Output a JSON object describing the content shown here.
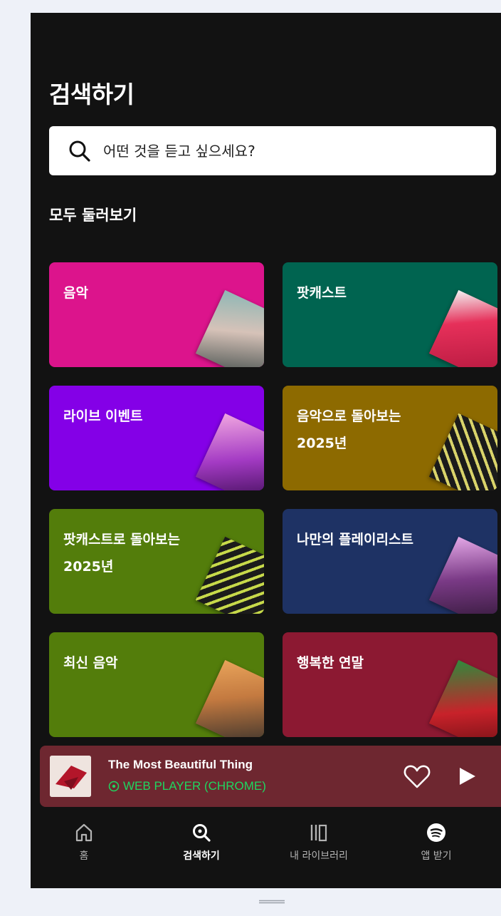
{
  "header": {
    "title": "검색하기"
  },
  "search": {
    "placeholder": "어떤 것을 듣고 싶으세요?"
  },
  "browse": {
    "title": "모두 둘러보기",
    "cards": [
      {
        "label": "음악",
        "color": "#dc148c"
      },
      {
        "label": "팟캐스트",
        "color": "#006450"
      },
      {
        "label": "라이브 이벤트",
        "color": "#8400e7"
      },
      {
        "label": "음악으로 돌아보는 2025년",
        "color": "#8d6a00"
      },
      {
        "label": "팟캐스트로 돌아보는 2025년",
        "color": "#537d0b"
      },
      {
        "label": "나만의 플레이리스트",
        "color": "#1e3264"
      },
      {
        "label": "최신 음악",
        "color": "#537d0b"
      },
      {
        "label": "행복한 연말",
        "color": "#8c1932"
      }
    ]
  },
  "now_playing": {
    "title": "The Most Beautiful Thing",
    "device": "WEB PLAYER (CHROME)",
    "device_icon": "speaker-icon",
    "accent": "#1ed760"
  },
  "nav": {
    "items": [
      {
        "label": "홈",
        "icon": "home-icon"
      },
      {
        "label": "검색하기",
        "icon": "search-icon",
        "active": true
      },
      {
        "label": "내 라이브러리",
        "icon": "library-icon"
      },
      {
        "label": "앱 받기",
        "icon": "spotify-icon"
      }
    ]
  }
}
